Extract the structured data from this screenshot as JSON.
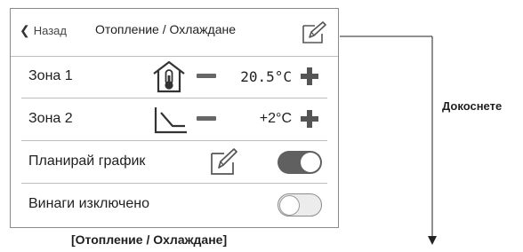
{
  "header": {
    "back_label": "Назад",
    "title": "Отопление / Охлаждане"
  },
  "rows": [
    {
      "label": "Зона 1",
      "icon": "thermometer-house-icon",
      "value": "20.5°C"
    },
    {
      "label": "Зона 2",
      "icon": "heating-curve-icon",
      "value": "+2°C"
    },
    {
      "label": "Планирай график",
      "icon": "edit-icon",
      "toggle": "on"
    },
    {
      "label": "Винаги изключено",
      "toggle": "off"
    }
  ],
  "caption": "[Отопление / Охлаждане]",
  "callout_label": "Докоснете",
  "colors": {
    "toggle_on": "#606060",
    "toggle_off": "#ececec",
    "icon": "#555555"
  }
}
